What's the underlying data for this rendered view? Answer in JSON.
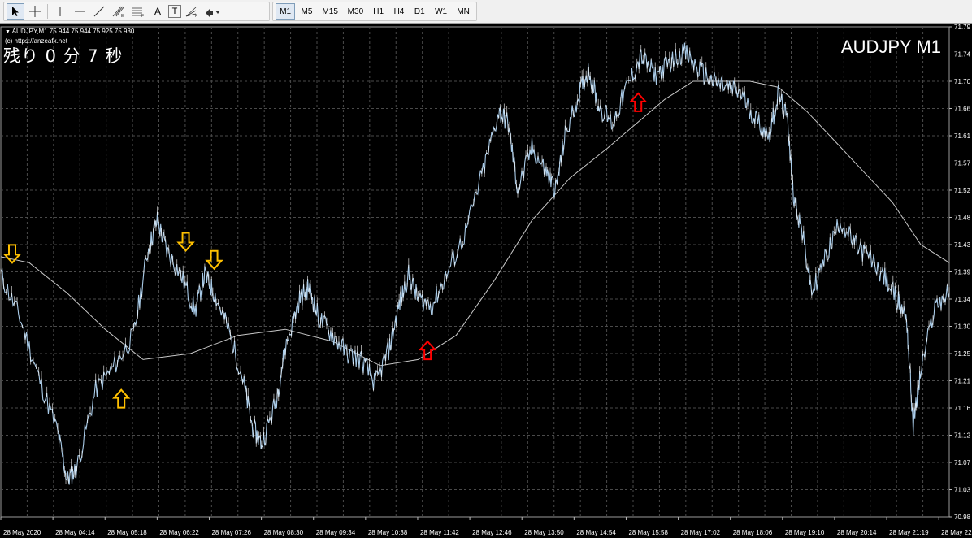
{
  "toolbar": {
    "tools": [
      {
        "name": "cursor-tool",
        "icon": "cursor-icon"
      },
      {
        "name": "crosshair-tool",
        "icon": "crosshair-icon"
      },
      {
        "name": "vertical-line-tool",
        "icon": "vertical-line-icon"
      },
      {
        "name": "horizontal-line-tool",
        "icon": "horizontal-line-icon"
      },
      {
        "name": "trendline-tool",
        "icon": "trendline-icon"
      },
      {
        "name": "fibonacci-tool",
        "icon": "fibonacci-icon"
      },
      {
        "name": "channel-tool",
        "icon": "channel-icon"
      },
      {
        "name": "text-tool",
        "label": "A"
      },
      {
        "name": "text-label-tool",
        "label": "T"
      },
      {
        "name": "fibo-fan-tool",
        "icon": "fibo-fan-icon"
      },
      {
        "name": "arrows-tool",
        "icon": "arrows-dropdown-icon"
      }
    ],
    "timeframes": [
      "M1",
      "M5",
      "M15",
      "M30",
      "H1",
      "H4",
      "D1",
      "W1",
      "MN"
    ],
    "active_timeframe": "M1"
  },
  "chart_header": {
    "info": "AUDJPY,M1  75.944 75.944 75.925 75.930",
    "copyright": "(c) https://anzeafx.net",
    "countdown": "残り 0 分 7 秒",
    "symbol_label": "AUDJPY M1"
  },
  "chart_data": {
    "type": "line",
    "symbol": "AUDJPY",
    "timeframe": "M1",
    "ylim": [
      70.98,
      71.79
    ],
    "y_ticks": [
      "71.79",
      "71.74",
      "71.70",
      "71.66",
      "71.61",
      "71.57",
      "71.52",
      "71.48",
      "71.43",
      "71.39",
      "71.34",
      "71.30",
      "71.25",
      "71.21",
      "71.16",
      "71.12",
      "71.07",
      "71.03",
      "70.98"
    ],
    "x_ticks": [
      "28 May 2020",
      "28 May 04:14",
      "28 May 05:18",
      "28 May 06:22",
      "28 May 07:26",
      "28 May 08:30",
      "28 May 09:34",
      "28 May 10:38",
      "28 May 11:42",
      "28 May 12:46",
      "28 May 13:50",
      "28 May 14:54",
      "28 May 15:58",
      "28 May 17:02",
      "28 May 18:06",
      "28 May 19:10",
      "28 May 20:14",
      "28 May 21:19",
      "28 May 22"
    ],
    "grid": true,
    "colors": {
      "background": "#000000",
      "grid": "#4a4a4a",
      "price": "#a9cbe8",
      "ma": "#c8c8c8",
      "up_arrow": "#ff0000",
      "down_arrow": "#ffc000"
    },
    "series": [
      {
        "kind": "price",
        "points": [
          [
            0,
            71.38
          ],
          [
            0.02,
            71.31
          ],
          [
            0.04,
            71.21
          ],
          [
            0.06,
            71.12
          ],
          [
            0.07,
            71.04
          ],
          [
            0.08,
            71.06
          ],
          [
            0.1,
            71.19
          ],
          [
            0.12,
            71.23
          ],
          [
            0.14,
            71.28
          ],
          [
            0.155,
            71.42
          ],
          [
            0.165,
            71.47
          ],
          [
            0.175,
            71.42
          ],
          [
            0.19,
            71.38
          ],
          [
            0.205,
            71.32
          ],
          [
            0.215,
            71.38
          ],
          [
            0.225,
            71.35
          ],
          [
            0.24,
            71.29
          ],
          [
            0.255,
            71.21
          ],
          [
            0.265,
            71.13
          ],
          [
            0.275,
            71.1
          ],
          [
            0.29,
            71.17
          ],
          [
            0.3,
            71.26
          ],
          [
            0.315,
            71.34
          ],
          [
            0.325,
            71.36
          ],
          [
            0.335,
            71.31
          ],
          [
            0.35,
            71.28
          ],
          [
            0.365,
            71.25
          ],
          [
            0.38,
            71.24
          ],
          [
            0.395,
            71.2
          ],
          [
            0.41,
            71.26
          ],
          [
            0.42,
            71.33
          ],
          [
            0.43,
            71.38
          ],
          [
            0.44,
            71.34
          ],
          [
            0.455,
            71.33
          ],
          [
            0.47,
            71.38
          ],
          [
            0.49,
            71.45
          ],
          [
            0.51,
            71.56
          ],
          [
            0.525,
            71.65
          ],
          [
            0.535,
            71.63
          ],
          [
            0.545,
            71.52
          ],
          [
            0.56,
            71.59
          ],
          [
            0.575,
            71.55
          ],
          [
            0.585,
            71.52
          ],
          [
            0.595,
            71.61
          ],
          [
            0.61,
            71.68
          ],
          [
            0.62,
            71.72
          ],
          [
            0.63,
            71.66
          ],
          [
            0.645,
            71.63
          ],
          [
            0.66,
            71.69
          ],
          [
            0.675,
            71.74
          ],
          [
            0.69,
            71.71
          ],
          [
            0.705,
            71.73
          ],
          [
            0.72,
            71.75
          ],
          [
            0.735,
            71.72
          ],
          [
            0.75,
            71.7
          ],
          [
            0.765,
            71.69
          ],
          [
            0.78,
            71.68
          ],
          [
            0.795,
            71.64
          ],
          [
            0.81,
            71.61
          ],
          [
            0.82,
            71.68
          ],
          [
            0.83,
            71.63
          ],
          [
            0.835,
            71.52
          ],
          [
            0.845,
            71.45
          ],
          [
            0.855,
            71.35
          ],
          [
            0.87,
            71.41
          ],
          [
            0.885,
            71.47
          ],
          [
            0.9,
            71.43
          ],
          [
            0.915,
            71.41
          ],
          [
            0.93,
            71.38
          ],
          [
            0.945,
            71.34
          ],
          [
            0.955,
            71.31
          ],
          [
            0.962,
            71.13
          ],
          [
            0.97,
            71.22
          ],
          [
            0.985,
            71.33
          ],
          [
            1,
            71.35
          ]
        ]
      },
      {
        "kind": "moving-average",
        "points": [
          [
            0,
            71.41
          ],
          [
            0.03,
            71.4
          ],
          [
            0.07,
            71.35
          ],
          [
            0.11,
            71.29
          ],
          [
            0.15,
            71.24
          ],
          [
            0.2,
            71.25
          ],
          [
            0.25,
            71.28
          ],
          [
            0.3,
            71.29
          ],
          [
            0.35,
            71.27
          ],
          [
            0.4,
            71.23
          ],
          [
            0.44,
            71.24
          ],
          [
            0.48,
            71.28
          ],
          [
            0.52,
            71.37
          ],
          [
            0.56,
            71.47
          ],
          [
            0.6,
            71.54
          ],
          [
            0.64,
            71.59
          ],
          [
            0.67,
            71.63
          ],
          [
            0.7,
            71.67
          ],
          [
            0.73,
            71.7
          ],
          [
            0.76,
            71.7
          ],
          [
            0.79,
            71.7
          ],
          [
            0.82,
            71.69
          ],
          [
            0.85,
            71.65
          ],
          [
            0.88,
            71.6
          ],
          [
            0.91,
            71.55
          ],
          [
            0.94,
            71.5
          ],
          [
            0.97,
            71.43
          ],
          [
            1,
            71.4
          ]
        ]
      }
    ],
    "annotations": [
      {
        "type": "down-arrow",
        "color": "yellow",
        "x": 0.012,
        "y": 71.4
      },
      {
        "type": "up-arrow",
        "color": "yellow",
        "x": 0.127,
        "y": 71.19
      },
      {
        "type": "down-arrow",
        "color": "yellow",
        "x": 0.195,
        "y": 71.42
      },
      {
        "type": "down-arrow",
        "color": "yellow",
        "x": 0.225,
        "y": 71.39
      },
      {
        "type": "up-arrow",
        "color": "red",
        "x": 0.45,
        "y": 71.27
      },
      {
        "type": "up-arrow",
        "color": "red",
        "x": 0.672,
        "y": 71.68
      }
    ]
  }
}
